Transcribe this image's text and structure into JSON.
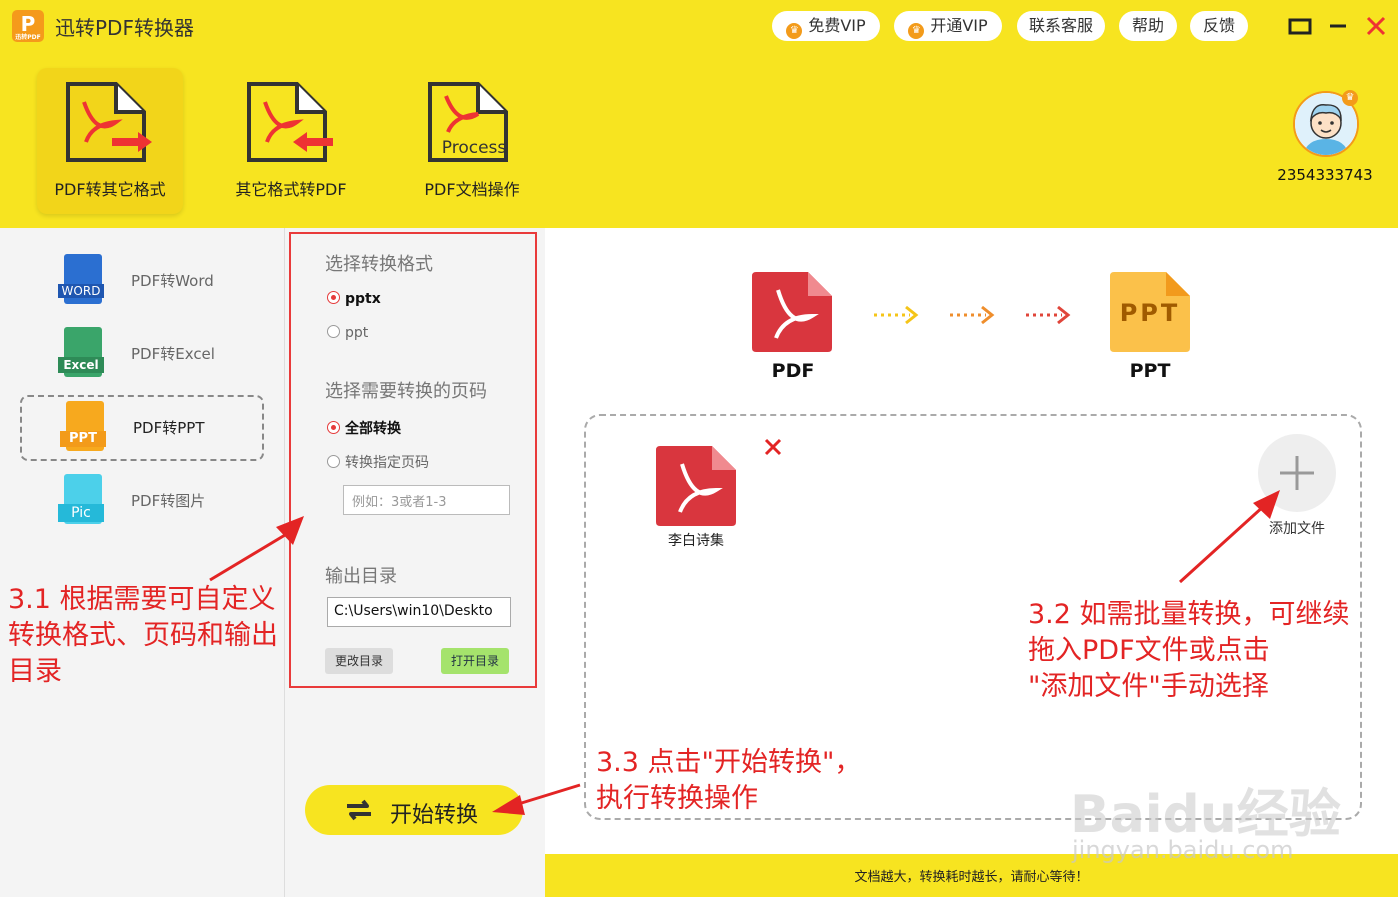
{
  "app": {
    "logo_text": "P",
    "logo_sub": "迅转PDF",
    "title": "迅转PDF转换器"
  },
  "titlebar": {
    "buttons": [
      {
        "label": "免费VIP",
        "icon": "crown-icon"
      },
      {
        "label": "开通VIP",
        "icon": "crown-icon"
      },
      {
        "label": "联系客服"
      },
      {
        "label": "帮助"
      },
      {
        "label": "反馈"
      }
    ]
  },
  "toolbar": {
    "tools": [
      {
        "label": "PDF转其它格式"
      },
      {
        "label": "其它格式转PDF"
      },
      {
        "label": "PDF文档操作",
        "icon_text": "Process"
      }
    ]
  },
  "user": {
    "id": "2354333743"
  },
  "sidebar": {
    "items": [
      {
        "label": "PDF转Word",
        "icon_text": "WORD",
        "color": "#2b6fd1"
      },
      {
        "label": "PDF转Excel",
        "icon_text": "Excel",
        "color": "#2e8b57"
      },
      {
        "label": "PDF转PPT",
        "icon_text": "PPT",
        "color": "#f39b1a"
      },
      {
        "label": "PDF转图片",
        "icon_text": "Pic",
        "color": "#25b9d9"
      }
    ]
  },
  "options": {
    "format_title": "选择转换格式",
    "formats": [
      "pptx",
      "ppt"
    ],
    "pages_title": "选择需要转换的页码",
    "page_options": [
      "全部转换",
      "转换指定页码"
    ],
    "page_placeholder": "例如：3或者1-3",
    "output_title": "输出目录",
    "output_dir": "C:\\Users\\win10\\Deskto",
    "change_dir": "更改目录",
    "open_dir": "打开目录"
  },
  "start_button": "开始转换",
  "conversion": {
    "from": "PDF",
    "to": "PPT",
    "to_icon": "PPT"
  },
  "file": {
    "name": "李白诗集"
  },
  "add_file": "添加文件",
  "bottom_notice": "文档越大，转换耗时越长，请耐心等待！",
  "annotations": {
    "a1": [
      "3.1 根据需要可自定义",
      "转换格式、页码和输出",
      "目录"
    ],
    "a2": [
      "3.2 如需批量转换，可继续",
      "拖入PDF文件或点击",
      "\"添加文件\"手动选择"
    ],
    "a3": [
      "3.3 点击\"开始转换\"，",
      "执行转换操作"
    ]
  },
  "watermark": {
    "main": "Baidu经验",
    "sub": "jingyan.baidu.com"
  },
  "colors": {
    "brand_yellow": "#f7e420",
    "accent_red": "#e32424",
    "pdf_red": "#d9363e"
  }
}
